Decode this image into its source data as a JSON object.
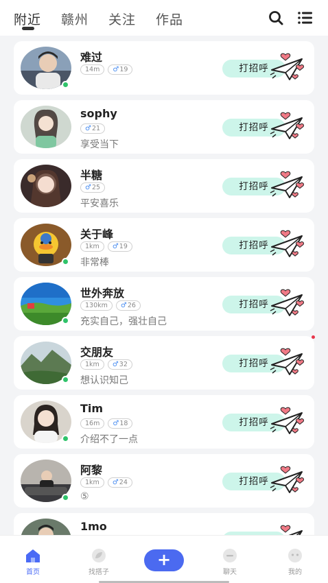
{
  "top_tabs": [
    {
      "label": "附近",
      "active": true
    },
    {
      "label": "赣州",
      "active": false
    },
    {
      "label": "关注",
      "active": false
    },
    {
      "label": "作品",
      "active": false
    }
  ],
  "greet_label": "打招呼",
  "users": [
    {
      "name": "难过",
      "tags": [
        "14m",
        "19"
      ],
      "signature": "",
      "online": true
    },
    {
      "name": "sophy",
      "tags": [
        "21"
      ],
      "signature": "享受当下",
      "online": false
    },
    {
      "name": "半糖",
      "tags": [
        "25"
      ],
      "signature": "平安喜乐",
      "online": false
    },
    {
      "name": "关于峰",
      "tags": [
        "1km",
        "19"
      ],
      "signature": "非常棒",
      "online": true
    },
    {
      "name": "世外奔放",
      "tags": [
        "130km",
        "26"
      ],
      "signature": "充实自己，强壮自己",
      "online": true
    },
    {
      "name": "交朋友",
      "tags": [
        "1km",
        "32"
      ],
      "signature": "想认识知己",
      "online": true
    },
    {
      "name": "Tim",
      "tags": [
        "16m",
        "18"
      ],
      "signature": "介绍不了一点",
      "online": true
    },
    {
      "name": "阿黎",
      "tags": [
        "1km",
        "24"
      ],
      "signature": "⑤",
      "online": true
    },
    {
      "name": "1mo",
      "tags": [],
      "signature": "",
      "online": false
    }
  ],
  "bottom_nav": [
    {
      "label": "首页",
      "active": true
    },
    {
      "label": "找搭子",
      "active": false
    },
    {
      "label": "聊天",
      "active": false
    },
    {
      "label": "我的",
      "active": false
    }
  ],
  "colors": {
    "accent": "#4b6af0",
    "greet_bg": "#cdf5ea",
    "online": "#2fc36a",
    "male": "#4a8df0"
  }
}
